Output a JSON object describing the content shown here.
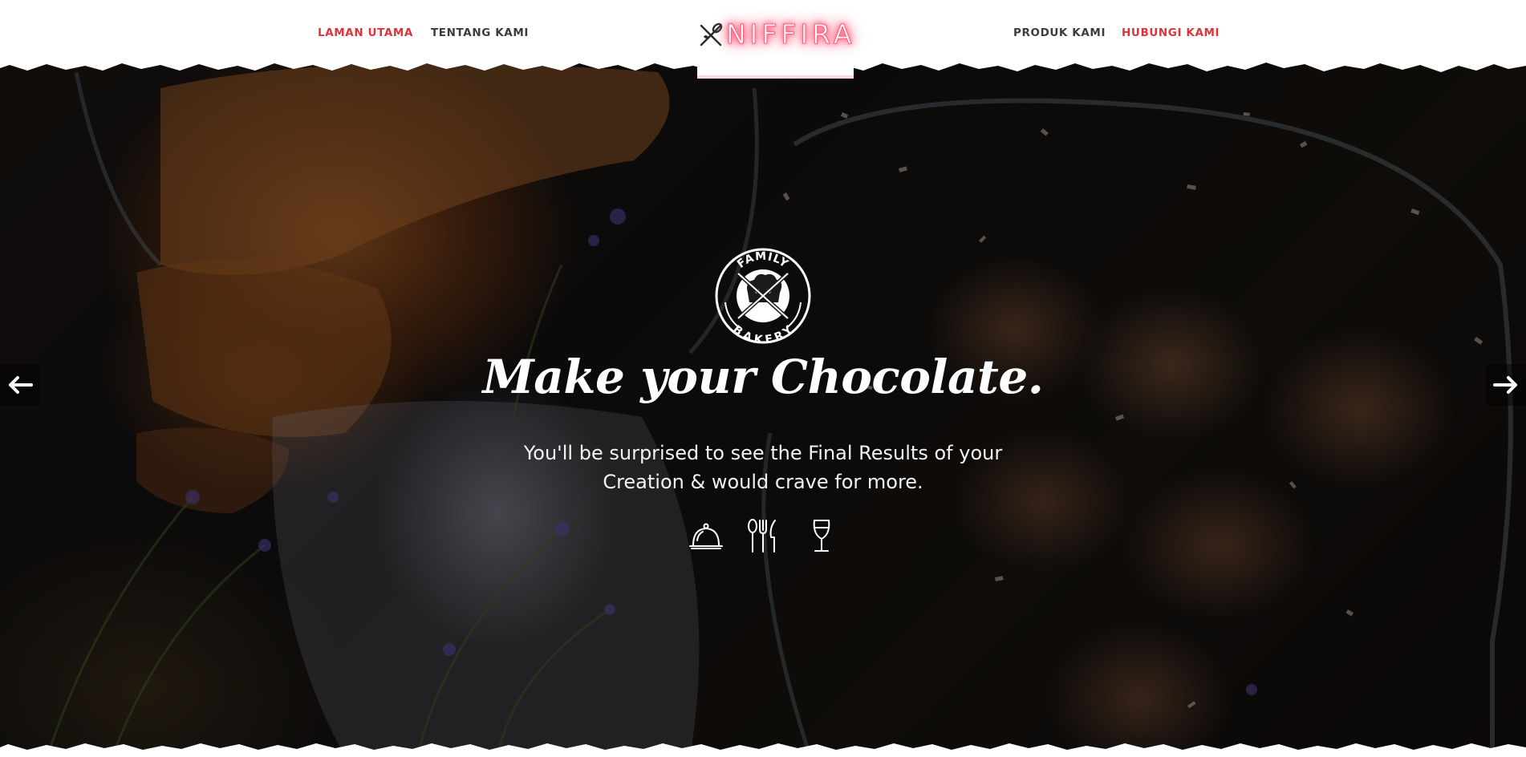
{
  "nav": {
    "left": [
      {
        "label": "LAMAN UTAMA",
        "active": true
      },
      {
        "label": "TENTANG KAMI",
        "active": false
      }
    ],
    "right": [
      {
        "label": "PRODUK KAMI",
        "active": false
      },
      {
        "label": "HUBUNGI KAMI",
        "active": true
      }
    ]
  },
  "brand": {
    "name": "NIFFIRA",
    "icon": "crossed-whisk-icon"
  },
  "hero": {
    "badge": {
      "top_text": "FAMILY",
      "bottom_text": "BAKERY",
      "icon": "chef-hat-crossed-knives-icon"
    },
    "headline": "Make your Chocolate.",
    "subtext": "You'll be surprised to see the Final Results of your Creation & would crave for more.",
    "feature_icons": [
      "cloche-icon",
      "cutlery-icon",
      "wine-glass-icon"
    ]
  },
  "slider": {
    "prev_icon": "arrow-left-icon",
    "next_icon": "arrow-right-icon"
  },
  "colors": {
    "accent": "#e0323c",
    "nav_text": "#3c3c3c",
    "brand_glow": "#ff4a6e",
    "hero_text": "#ffffff"
  }
}
